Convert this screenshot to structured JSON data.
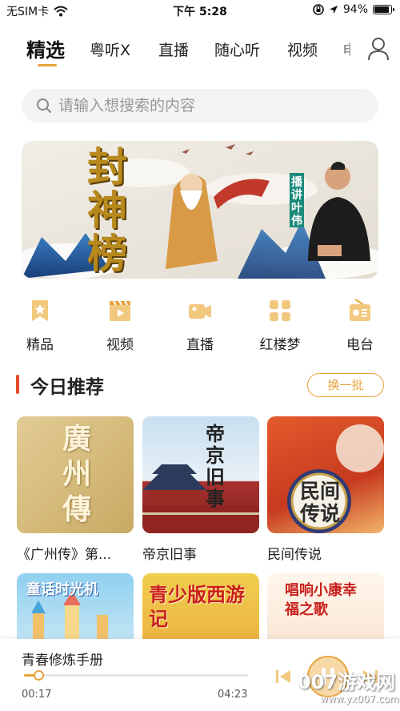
{
  "status_bar": {
    "carrier": "无SIM卡",
    "time": "下午 5:28",
    "battery": "94%",
    "battery_level": 0.94
  },
  "tabs": [
    {
      "label": "精选",
      "active": true
    },
    {
      "label": "粤听X",
      "active": false
    },
    {
      "label": "直播",
      "active": false
    },
    {
      "label": "随心听",
      "active": false
    },
    {
      "label": "视频",
      "active": false
    },
    {
      "label": "电",
      "active": false
    }
  ],
  "search": {
    "placeholder": "请输入想搜索的内容"
  },
  "banner": {
    "title": "封神榜",
    "host_tag": "播讲叶伟"
  },
  "categories": [
    {
      "label": "精品",
      "icon": "bookmark-star-icon"
    },
    {
      "label": "视频",
      "icon": "video-clapper-icon"
    },
    {
      "label": "直播",
      "icon": "camera-icon"
    },
    {
      "label": "红楼梦",
      "icon": "grid-icon"
    },
    {
      "label": "电台",
      "icon": "radio-icon"
    }
  ],
  "section": {
    "title": "今日推荐",
    "refresh_label": "换一批"
  },
  "recommendations": [
    {
      "title": "《广州传》第...",
      "cover_text": "廣州傳"
    },
    {
      "title": "帝京旧事",
      "cover_text": "帝京旧事"
    },
    {
      "title": "民间传说",
      "cover_text": "民间传说"
    },
    {
      "title": "",
      "cover_text": "童话时光机"
    },
    {
      "title": "",
      "cover_text": "青少版西游记"
    },
    {
      "title": "",
      "cover_text": "唱响小康幸福之歌"
    }
  ],
  "player": {
    "title": "青春修炼手册",
    "current_time": "00:17",
    "total_time": "04:23",
    "progress": 0.065
  },
  "watermark": {
    "main": "007游戏网",
    "url": "www.yx007.com"
  },
  "colors": {
    "accent": "#e8a33d",
    "section_bar": "#e14a2a"
  }
}
